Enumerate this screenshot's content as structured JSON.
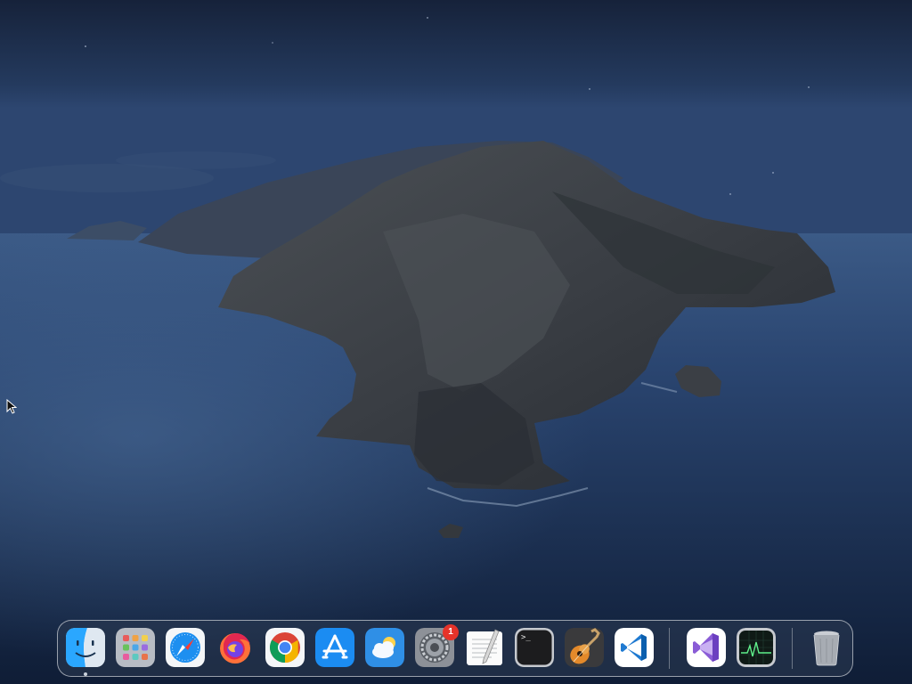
{
  "desktop": {
    "wallpaper": "macos-catalina-night-island"
  },
  "dock": {
    "apps": [
      {
        "id": "finder",
        "icon": "finder-icon",
        "running": true
      },
      {
        "id": "launchpad",
        "icon": "launchpad-icon",
        "running": false
      },
      {
        "id": "safari",
        "icon": "safari-icon",
        "running": false
      },
      {
        "id": "firefox",
        "icon": "firefox-icon",
        "running": false
      },
      {
        "id": "chrome",
        "icon": "chrome-icon",
        "running": false
      },
      {
        "id": "app-store",
        "icon": "app-store-icon",
        "running": false
      },
      {
        "id": "weather",
        "icon": "weather-icon",
        "running": false
      },
      {
        "id": "system-preferences",
        "icon": "gear-icon",
        "running": false,
        "badge": "1"
      },
      {
        "id": "textedit",
        "icon": "textedit-icon",
        "running": false
      },
      {
        "id": "terminal",
        "icon": "terminal-icon",
        "running": false
      },
      {
        "id": "garageband",
        "icon": "guitar-icon",
        "running": false
      },
      {
        "id": "vscode",
        "icon": "vscode-icon",
        "running": false
      },
      {
        "id": "visual-studio",
        "icon": "visual-studio-icon",
        "running": false
      },
      {
        "id": "activity-monitor",
        "icon": "activity-monitor-icon",
        "running": false
      },
      {
        "id": "trash",
        "icon": "trash-icon",
        "running": false
      }
    ],
    "terminal_prompt": ">_"
  }
}
